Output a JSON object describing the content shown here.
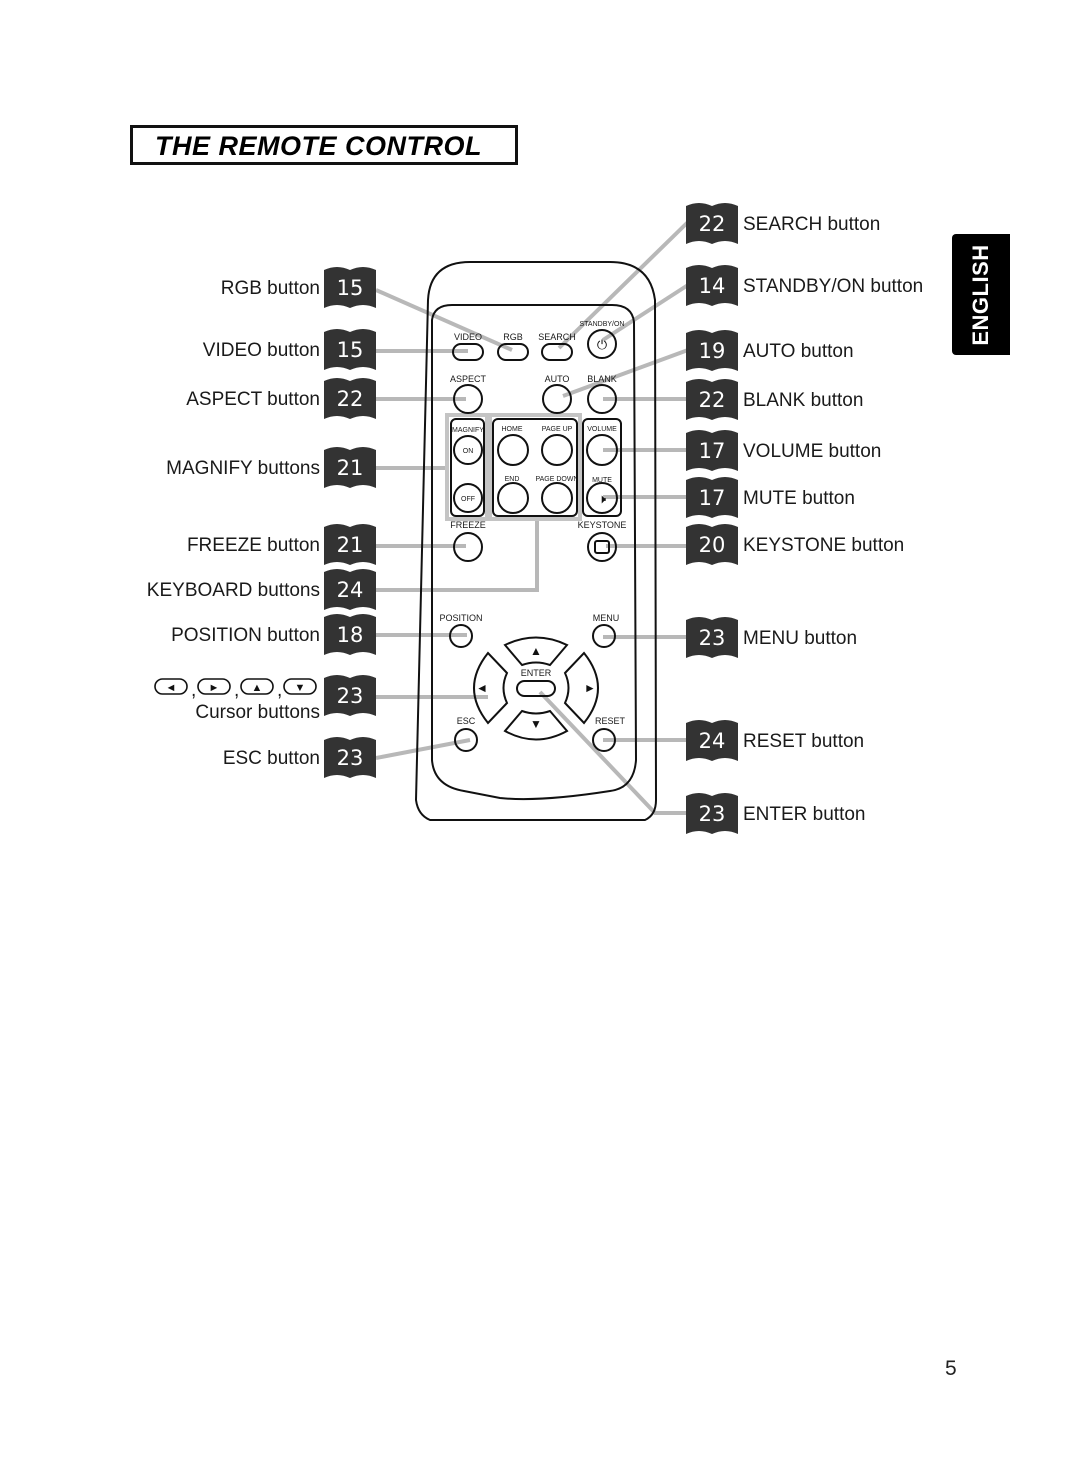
{
  "title": "THE REMOTE CONTROL",
  "language_tab": "ENGLISH",
  "page_number": "5",
  "colors": {
    "badge": "#333333",
    "leader_line": "#b8b8b8",
    "outline": "#111111"
  },
  "left_callouts": [
    {
      "label": "RGB button",
      "page": "15"
    },
    {
      "label": "VIDEO button",
      "page": "15"
    },
    {
      "label": "ASPECT button",
      "page": "22"
    },
    {
      "label": "MAGNIFY buttons",
      "page": "21"
    },
    {
      "label": "FREEZE button",
      "page": "21"
    },
    {
      "label": "KEYBOARD buttons",
      "page": "24"
    },
    {
      "label": "POSITION button",
      "page": "18"
    },
    {
      "label": "Cursor buttons",
      "page": "23",
      "icons": [
        "left-arrow",
        "right-arrow",
        "up-arrow",
        "down-arrow"
      ],
      "separator": ","
    },
    {
      "label": "ESC button",
      "page": "23"
    }
  ],
  "right_callouts": [
    {
      "label": "SEARCH button",
      "page": "22"
    },
    {
      "label": "STANDBY/ON button",
      "page": "14"
    },
    {
      "label": "AUTO button",
      "page": "19"
    },
    {
      "label": "BLANK button",
      "page": "22"
    },
    {
      "label": "VOLUME button",
      "page": "17"
    },
    {
      "label": "MUTE button",
      "page": "17"
    },
    {
      "label": "KEYSTONE button",
      "page": "20"
    },
    {
      "label": "MENU button",
      "page": "23"
    },
    {
      "label": "RESET button",
      "page": "24"
    },
    {
      "label": "ENTER button",
      "page": "23"
    }
  ],
  "remote_labels": {
    "video": "VIDEO",
    "rgb": "RGB",
    "search": "SEARCH",
    "standby": "STANDBY/ON",
    "aspect": "ASPECT",
    "auto": "AUTO",
    "blank": "BLANK",
    "magnify": "MAGNIFY",
    "on": "ON",
    "off": "OFF",
    "home": "HOME",
    "page_up": "PAGE UP",
    "end": "END",
    "page_down": "PAGE DOWN",
    "volume": "VOLUME",
    "mute": "MUTE",
    "freeze": "FREEZE",
    "keystone": "KEYSTONE",
    "position": "POSITION",
    "menu": "MENU",
    "enter": "ENTER",
    "esc": "ESC",
    "reset": "RESET"
  }
}
